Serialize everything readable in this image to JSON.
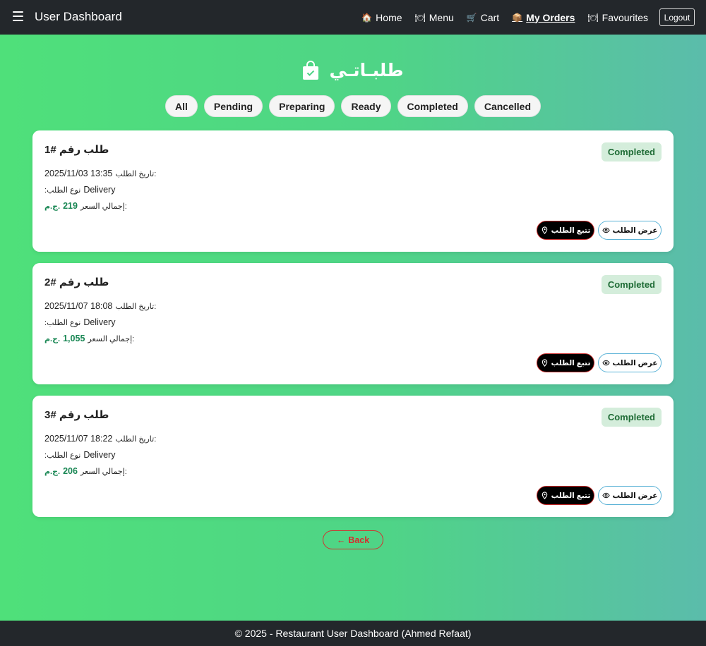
{
  "navbar": {
    "brand": "User Dashboard",
    "links": [
      {
        "icon": "🏠",
        "icon_name": "home-icon",
        "label": "Home"
      },
      {
        "icon": "🍽",
        "icon_name": "menu-icon",
        "label": "Menu"
      },
      {
        "icon": "🛒",
        "icon_name": "cart-icon",
        "label": "Cart"
      },
      {
        "icon": "📦",
        "icon_name": "box-icon",
        "label": "My Orders"
      },
      {
        "icon": "🍽",
        "icon_name": "favourites-icon",
        "label": "Favourites"
      }
    ],
    "logout": "Logout"
  },
  "page": {
    "title": "طلبـاتـي"
  },
  "filters": [
    "All",
    "Pending",
    "Preparing",
    "Ready",
    "Completed",
    "Cancelled"
  ],
  "labels": {
    "date": "تاريخ الطلب:",
    "type": ":نوع الطلب",
    "total": "إجمالي السعر:",
    "currency": "ج.م.",
    "view": "عرض الطلب",
    "track": "تتبع الطلب"
  },
  "orders": [
    {
      "title": "طلب رقم #1",
      "status": "Completed",
      "date": "2025/11/03 13:35",
      "type": "Delivery",
      "total": "219"
    },
    {
      "title": "طلب رقم #2",
      "status": "Completed",
      "date": "2025/11/07 18:08",
      "type": "Delivery",
      "total": "1,055"
    },
    {
      "title": "طلب رقم #3",
      "status": "Completed",
      "date": "2025/11/07 18:22",
      "type": "Delivery",
      "total": "206"
    }
  ],
  "back": "Back",
  "back_arrow": "←",
  "footer": "© 2025 - Restaurant User Dashboard (Ahmed Refaat)",
  "colors": {
    "navbar": "#23272b",
    "gradient_start": "#4fe07a",
    "gradient_end": "#5bbcab",
    "badge_bg": "#d4eddb",
    "badge_text": "#1e6b35",
    "price": "#198754",
    "back": "#d32f2f"
  }
}
